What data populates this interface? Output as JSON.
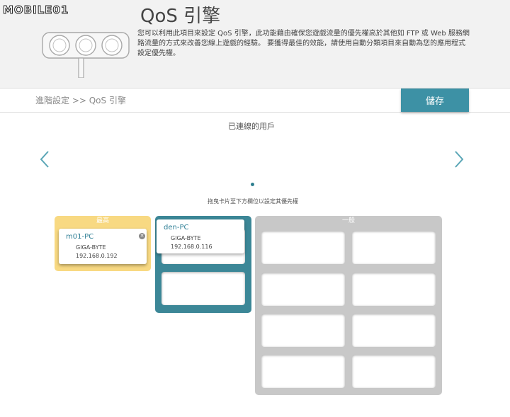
{
  "watermark": "MOBILE01",
  "header": {
    "title": "QoS 引擎",
    "description": "您可以利用此項目來設定 QoS 引擎，此功能藉由確保您遊戲流量的優先權高於其他如 FTP 或 Web 服務網路流量的方式來改善您線上遊戲的經驗。 要獲得最佳的效能，請使用自動分類項目來自動為您的應用程式設定優先權。"
  },
  "toolbar": {
    "breadcrumb": "進階設定 >> QoS 引擎",
    "save_label": "儲存"
  },
  "connected": {
    "title": "已連線的用戶",
    "hint": "拖曳卡片至下方欄位以設定其優先權"
  },
  "panels": {
    "highest": {
      "label": "最高",
      "devices": [
        {
          "name": "m01-PC",
          "vendor": "GIGA-BYTE",
          "ip": "192.168.0.192"
        }
      ]
    },
    "high": {
      "label": "",
      "devices": [
        {
          "name": "den-PC",
          "vendor": "GIGA-BYTE",
          "ip": "192.168.0.116"
        }
      ]
    },
    "normal": {
      "label": "一般"
    }
  },
  "icons": {
    "prev": "chevron-left-icon",
    "next": "chevron-right-icon",
    "remove": "close-icon"
  },
  "colors": {
    "accent": "#3d91a5",
    "highest": "#f8d982",
    "high": "#3c8797",
    "normal": "#c8c8c8"
  }
}
